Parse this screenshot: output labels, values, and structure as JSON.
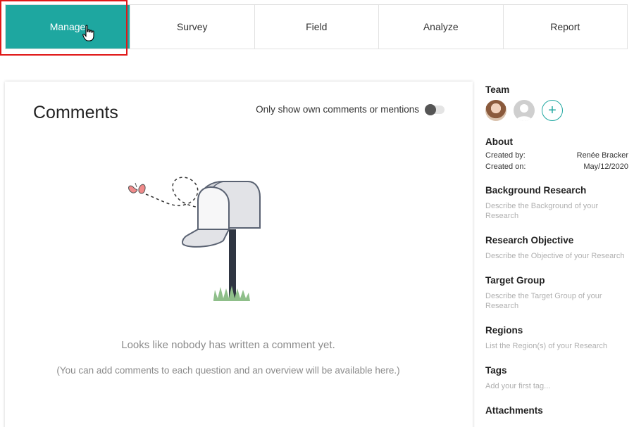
{
  "tabs": [
    {
      "label": "Manage",
      "active": true
    },
    {
      "label": "Survey",
      "active": false
    },
    {
      "label": "Field",
      "active": false
    },
    {
      "label": "Analyze",
      "active": false
    },
    {
      "label": "Report",
      "active": false
    }
  ],
  "comments": {
    "title": "Comments",
    "toggle_label": "Only show own comments or mentions",
    "toggle_on": false,
    "empty_message": "Looks like nobody has written a comment yet.",
    "empty_hint": "(You can add comments to each question and an overview will be available here.)"
  },
  "sidebar": {
    "team": {
      "title": "Team",
      "add_label": "+"
    },
    "about": {
      "title": "About",
      "created_by_label": "Created by:",
      "created_by_value": "Renée Bracker",
      "created_on_label": "Created on:",
      "created_on_value": "May/12/2020"
    },
    "background": {
      "title": "Background Research",
      "placeholder": "Describe the Background of your Research"
    },
    "objective": {
      "title": "Research Objective",
      "placeholder": "Describe the Objective of your Research"
    },
    "target": {
      "title": "Target Group",
      "placeholder": "Describe the Target Group of your Research"
    },
    "regions": {
      "title": "Regions",
      "placeholder": "List the Region(s) of your Research"
    },
    "tags": {
      "title": "Tags",
      "placeholder": "Add your first tag..."
    },
    "attachments": {
      "title": "Attachments"
    }
  },
  "colors": {
    "accent": "#1ea7a0",
    "highlight": "#e01818"
  }
}
